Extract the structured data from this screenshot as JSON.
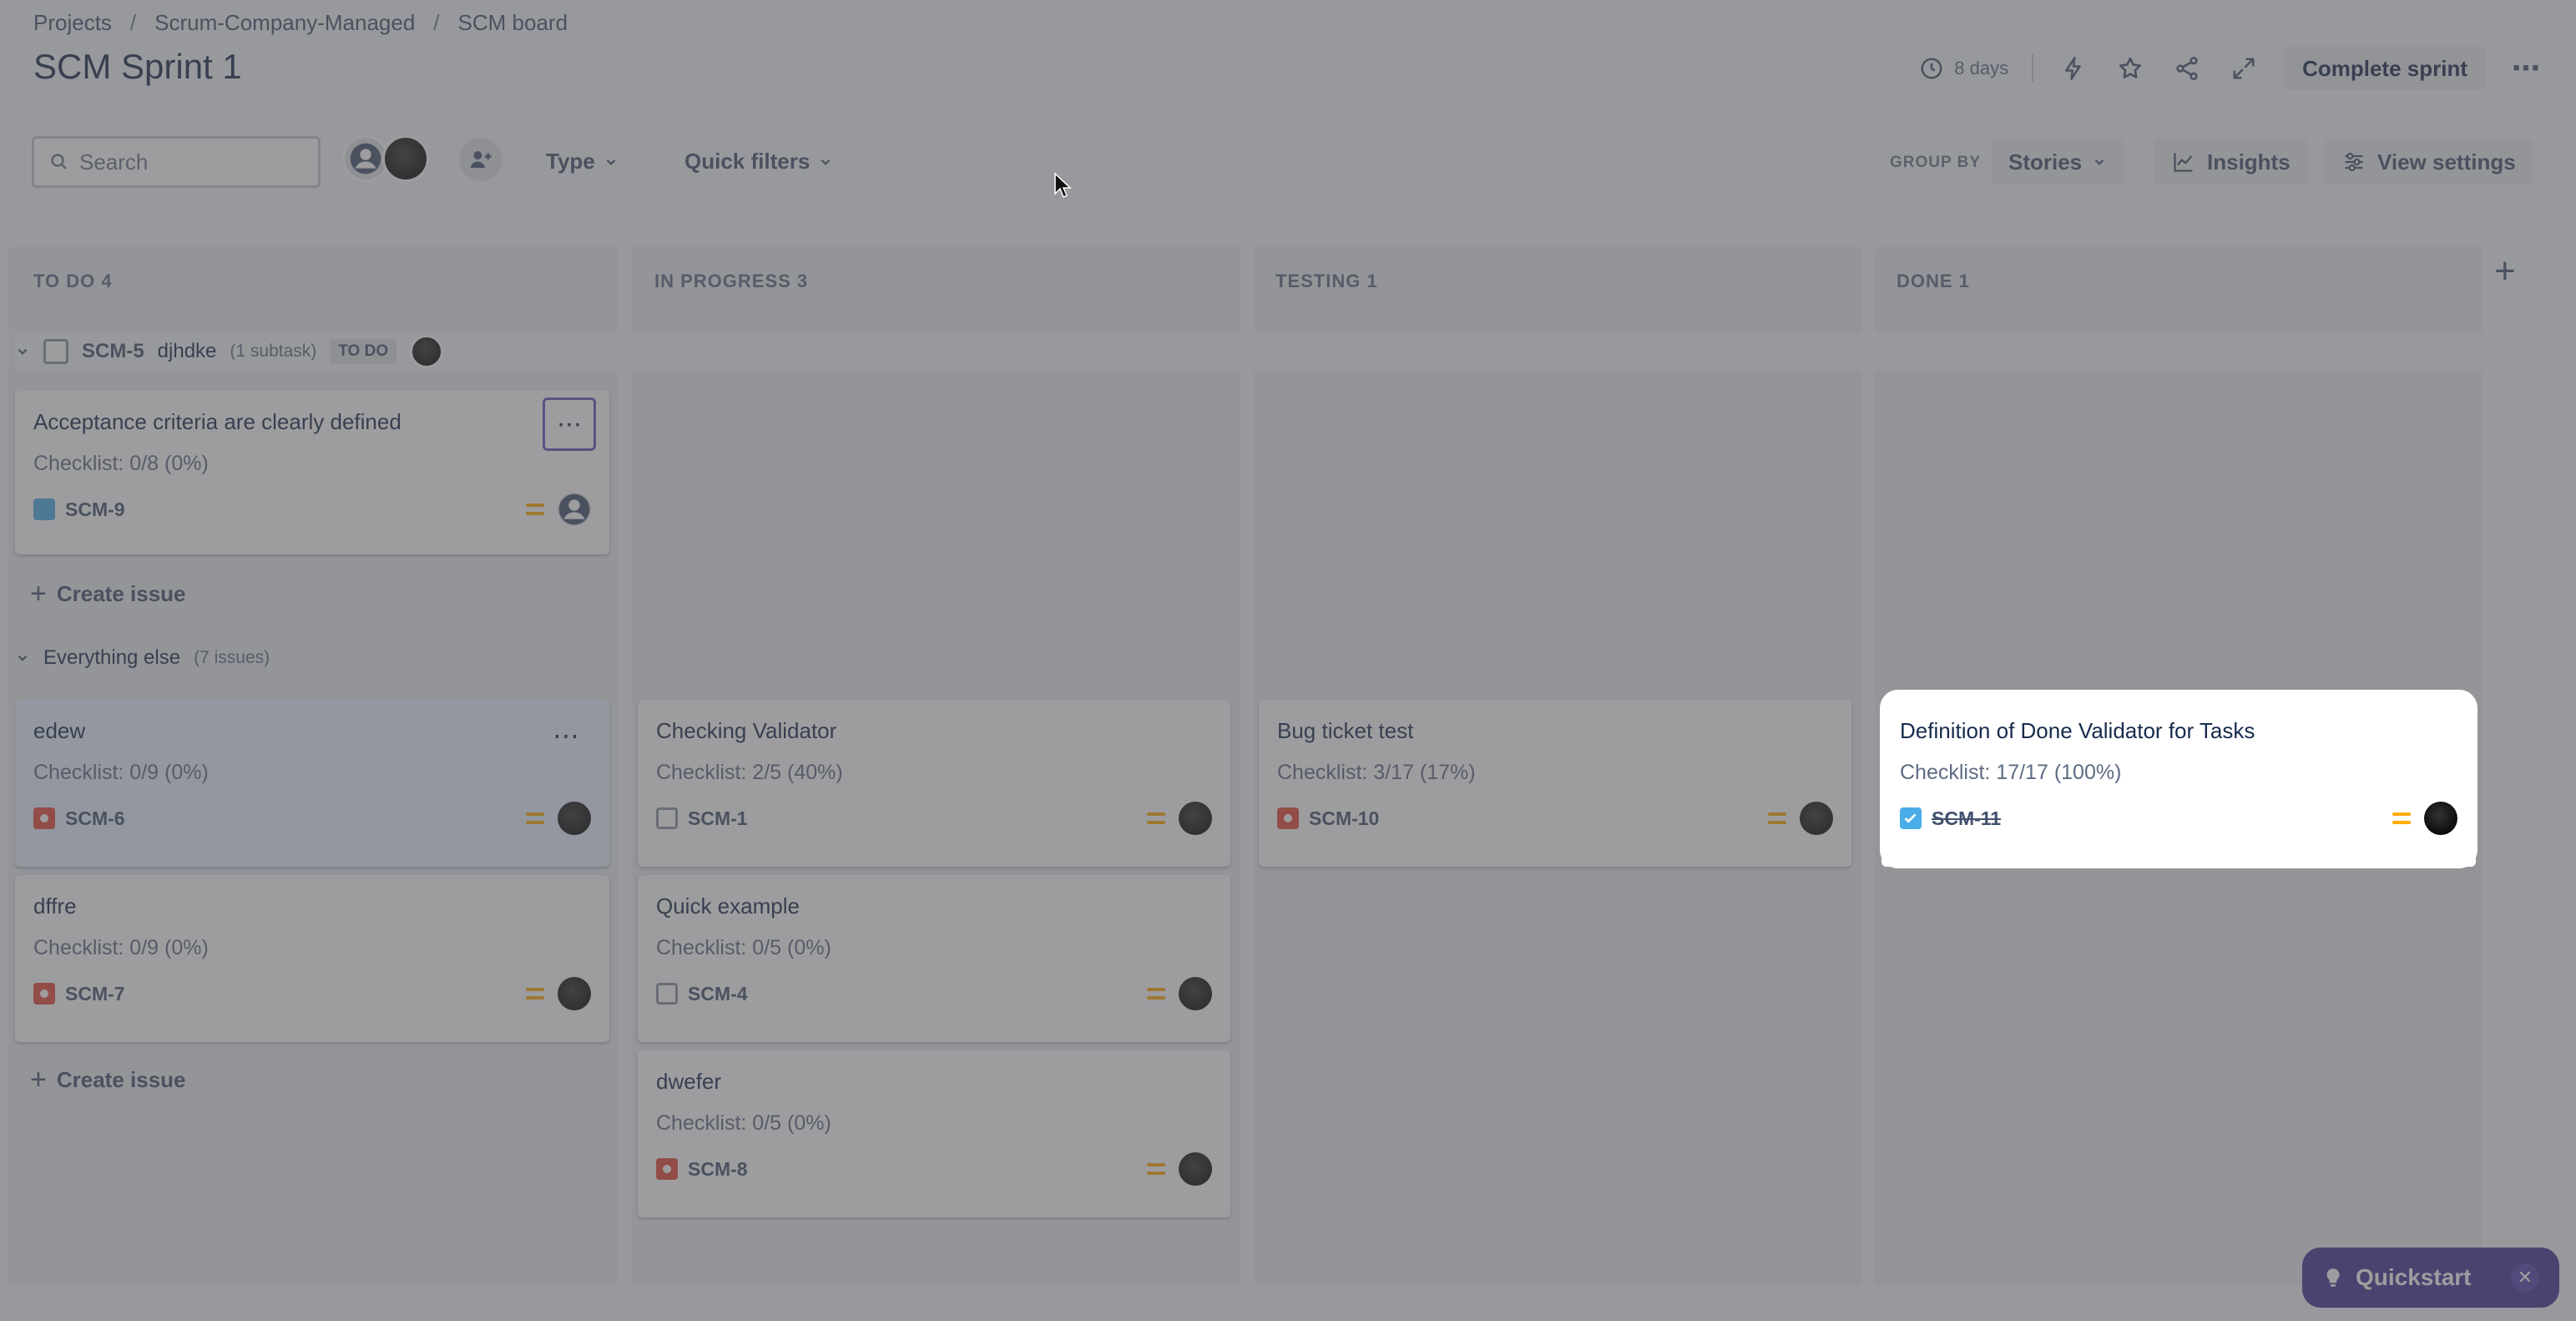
{
  "breadcrumb": [
    "Projects",
    "Scrum-Company-Managed",
    "SCM board"
  ],
  "sprint_title": "SCM Sprint 1",
  "header": {
    "days_remaining": "8 days",
    "complete_sprint_label": "Complete sprint"
  },
  "filters": {
    "search_placeholder": "Search",
    "type_label": "Type",
    "quick_filters_label": "Quick filters",
    "group_by_label": "GROUP BY",
    "group_by_value": "Stories",
    "insights_label": "Insights",
    "view_settings_label": "View settings"
  },
  "columns": [
    {
      "title": "TO DO 4"
    },
    {
      "title": "IN PROGRESS 3"
    },
    {
      "title": "TESTING 1"
    },
    {
      "title": "DONE 1"
    }
  ],
  "swimlane_story": {
    "key": "SCM-5",
    "name": "djhdke",
    "subtasks": "(1 subtask)",
    "status": "TO DO"
  },
  "swimlane_else": {
    "name": "Everything else",
    "count": "(7 issues)"
  },
  "story_card": {
    "title": "Acceptance criteria are clearly defined",
    "checklist": "Checklist: 0/8 (0%)",
    "key": "SCM-9"
  },
  "create_issue_label": "Create issue",
  "cards": {
    "edew": {
      "title": "edew",
      "checklist": "Checklist: 0/9 (0%)",
      "key": "SCM-6"
    },
    "dffre": {
      "title": "dffre",
      "checklist": "Checklist: 0/9 (0%)",
      "key": "SCM-7"
    },
    "checking": {
      "title": "Checking Validator",
      "checklist": "Checklist: 2/5 (40%)",
      "key": "SCM-1"
    },
    "quick": {
      "title": "Quick example",
      "checklist": "Checklist: 0/5 (0%)",
      "key": "SCM-4"
    },
    "dwefer": {
      "title": "dwefer",
      "checklist": "Checklist: 0/5 (0%)",
      "key": "SCM-8"
    },
    "bug": {
      "title": "Bug ticket test",
      "checklist": "Checklist: 3/17 (17%)",
      "key": "SCM-10"
    },
    "dod": {
      "title": "Definition of Done Validator for Tasks",
      "checklist": "Checklist: 17/17 (100%)",
      "key": "SCM-11"
    }
  },
  "quickstart": {
    "label": "Quickstart"
  },
  "colors": {
    "accent": "#6554c0",
    "quickstart": "#403294",
    "bug": "#e5493a",
    "subtask": "#4bade8",
    "priority": "#ffab00"
  }
}
